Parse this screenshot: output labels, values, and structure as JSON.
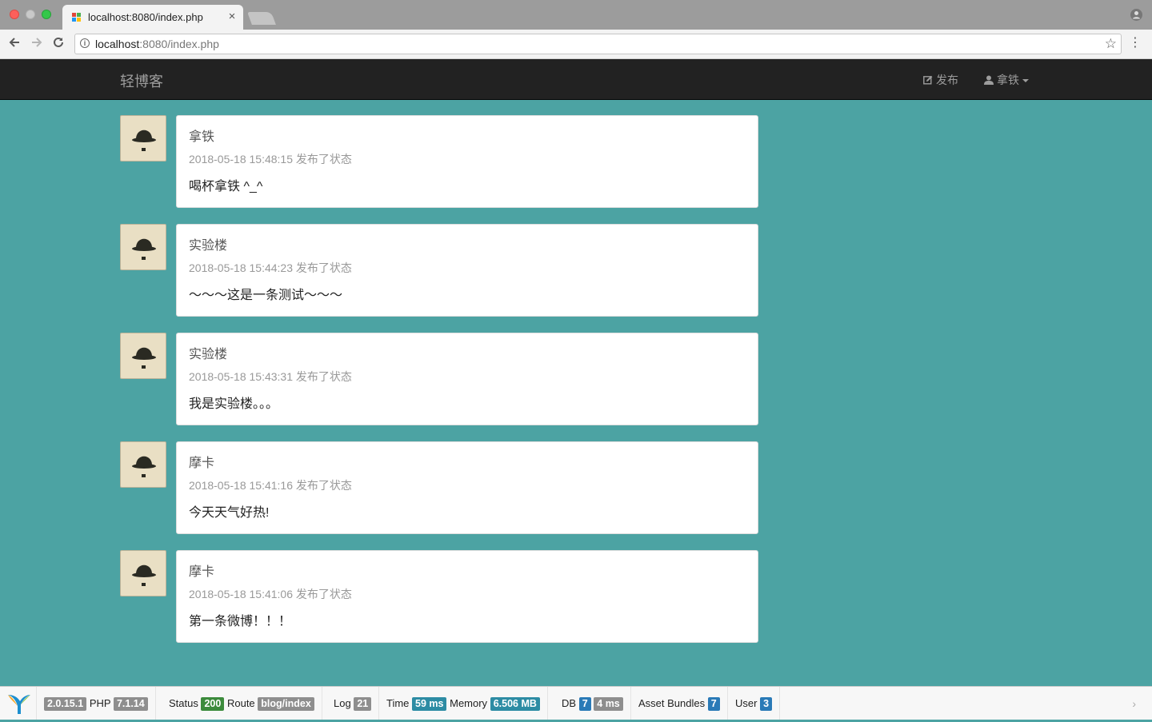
{
  "browser": {
    "tab_title": "localhost:8080/index.php",
    "tab_close": "×",
    "url_host": "localhost",
    "url_rest": ":8080/index.php",
    "back_icon": "arrow-left-icon",
    "forward_icon": "arrow-right-icon",
    "reload_icon": "reload-icon",
    "star_icon": "star-icon",
    "menu_icon": "kebab-menu-icon"
  },
  "navbar": {
    "brand": "轻博客",
    "publish_label": "发布",
    "user_label": "拿铁"
  },
  "posts": [
    {
      "author": "拿铁",
      "timestamp": "2018-05-18 15:48:15",
      "action": "发布了状态",
      "content": "喝杯拿铁 ^_^"
    },
    {
      "author": "实验楼",
      "timestamp": "2018-05-18 15:44:23",
      "action": "发布了状态",
      "content": "～～～这是一条测试～～～"
    },
    {
      "author": "实验楼",
      "timestamp": "2018-05-18 15:43:31",
      "action": "发布了状态",
      "content": "我是实验楼。。。"
    },
    {
      "author": "摩卡",
      "timestamp": "2018-05-18 15:41:16",
      "action": "发布了状态",
      "content": "今天天气好热!"
    },
    {
      "author": "摩卡",
      "timestamp": "2018-05-18 15:41:06",
      "action": "发布了状态",
      "content": "第一条微博！！！"
    }
  ],
  "debug": {
    "yii_version": "2.0.15.1",
    "php_label": "PHP",
    "php_version": "7.1.14",
    "status_label": "Status",
    "status_code": "200",
    "route_label": "Route",
    "route": "blog/index",
    "log_label": "Log",
    "log_count": "21",
    "time_label": "Time",
    "time_value": "59 ms",
    "memory_label": "Memory",
    "memory_value": "6.506 MB",
    "db_label": "DB",
    "db_count": "7",
    "db_time": "4 ms",
    "assets_label": "Asset Bundles",
    "assets_count": "7",
    "user_label": "User",
    "user_id": "3",
    "toggle": "›"
  },
  "colors": {
    "page_background": "#4ca3a3",
    "navbar": "#222222",
    "status_ok": "#3c8b3c",
    "info_badge": "#2a7ab7"
  }
}
